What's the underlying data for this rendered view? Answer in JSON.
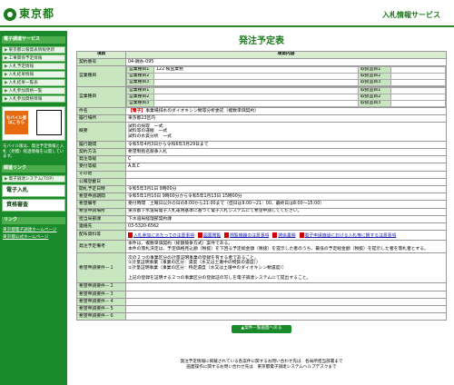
{
  "header": {
    "logo_text": "東京都",
    "service": "入札情報サービス"
  },
  "sidebar": {
    "menu_title": "電子調達サービス",
    "items": [
      "東京都公報発表情報更新",
      "工事関係予定情報",
      "入札予定情報",
      "入札結果情報",
      "入札結果一覧表",
      "入札参加資格一覧",
      "入札参加資格情報"
    ],
    "mobile_label": "モバイル版はこちら",
    "mobile_text": "モバイル版は、発注予定情報と入札（見積）経過情報を公開しています。",
    "links_title": "関連リンク",
    "portal": "電子調達システム(TOP)",
    "big1": "電子入札",
    "big2": "資格審査",
    "ext_title": "リンク",
    "ext1": "東京都電子調達ホームページ",
    "ext2": "東京都公式ホームページ"
  },
  "page_title": "発注予定表",
  "table": {
    "col1": "項目",
    "col2": "項目内容",
    "rows": [
      {
        "k": "契約番号",
        "v": "04-錦糸-095"
      },
      {
        "k": "営業種目",
        "v": "営業種目1　122 検査業務",
        "sub": [
          "営業種目2",
          "営業種目3"
        ],
        "r": [
          "取扱品目1",
          "取扱品目2",
          "取扱品目3"
        ]
      },
      {
        "k": "営業種目",
        "v": "営業種目1",
        "sub": [
          "営業種目2",
          "営業種目3"
        ],
        "r": [
          "取扱品目1",
          "取扱品目2",
          "取扱品目3"
        ]
      },
      {
        "k": "件名",
        "v": "【電子】事業場排水のダイオキシン類等分析委託（複数単価契約）"
      },
      {
        "k": "履行場所",
        "v": "東京都23区内"
      },
      {
        "k": "概要",
        "v": "試料の採取　一式\n試料等の運搬　一式\n試料の水質分析　一式"
      },
      {
        "k": "履行期間",
        "v": "令和5年4月3日から令和6年3月29日まで"
      },
      {
        "k": "契約方法",
        "v": "希望制指名競争入札"
      },
      {
        "k": "発注等級",
        "v": "C"
      },
      {
        "k": "受付等級",
        "v": "A,B,C"
      },
      {
        "k": "その他",
        "v": ""
      },
      {
        "k": "公報登載日",
        "v": ""
      },
      {
        "k": "開札予定日時",
        "v": "令和5年3月1日 9時00分"
      },
      {
        "k": "希望申請期間",
        "v": "令和5年1月10日 9時00分から令和5年1月13日 15時00分"
      },
      {
        "k": "希望備考",
        "v": "受付時間　土曜日以外の日の8:00から21:00まで（但日は9:00～21：00、最終日は8:00～15:00）"
      },
      {
        "k": "希望申請場所",
        "v": "東京都下水道局電子入札運用基準に基づく電子入札システムにて希望申請してください。"
      },
      {
        "k": "担当局部課",
        "v": "下水道局経理部契約課"
      },
      {
        "k": "連絡先",
        "v": "03-5320-6562"
      },
      {
        "k": "配布資料等",
        "v": ""
      },
      {
        "k": "発注予定備考",
        "v": "本件は、複数単価契約（総額競争方式）案件である。\n本件の落札決定は、予定価格見込額（税抜）を下回る予定総金額（税抜）を提示した者のうち、最低の予定総金額（税抜）を提示した者を落札者とする。"
      },
      {
        "k": "希望申請要件－１",
        "v": "次の２つの事業区分の計量証明事業の登録を有する者であること。\n①計量証明事業（事業の区分：濃度（水又は土壌中の物質の濃度））\n②計量証明事業（事業の区分：特定濃度（水又は土壌中のダイオキシン類濃度））\n\n上記の登録を証明する２つの事業区分の登録証の写しを電子調達システムにて提出すること。"
      },
      {
        "k": "希望申請要件－２",
        "v": ""
      },
      {
        "k": "希望申請要件－３",
        "v": ""
      },
      {
        "k": "希望申請要件－４",
        "v": ""
      },
      {
        "k": "希望申請要件－５",
        "v": ""
      },
      {
        "k": "希望申請要件－６",
        "v": ""
      }
    ],
    "docs": [
      "入札参加にあたっての注意事項",
      "図面閲覧",
      "閲覧機器の注意事項",
      "関係書類",
      "電子申請施設における入札等に関する注意事項"
    ]
  },
  "back_button": "▲案件一覧画面へ戻る",
  "footer": [
    "発注予定情報に掲載されている各案件に関するお問い合わせ先は　各局所担当部署まで",
    "画面操作に関するお問い合わせ先は　東京都電子調達システムヘルプデスクまで"
  ]
}
